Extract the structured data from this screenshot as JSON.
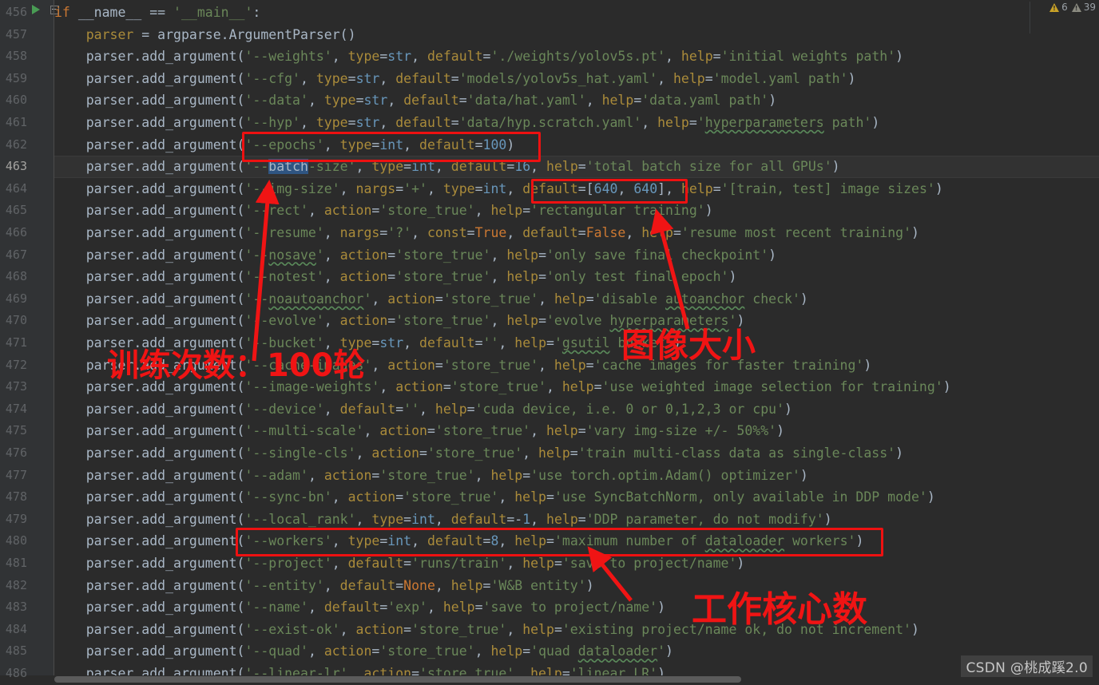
{
  "editor": {
    "first_line_number": 456,
    "current_line_number": 463,
    "selected_text": "batch",
    "lines": [
      {
        "n": 456,
        "text": "if __name__ == '__main__':"
      },
      {
        "n": 457,
        "text": "    parser = argparse.ArgumentParser()"
      },
      {
        "n": 458,
        "text": "    parser.add_argument('--weights', type=str, default='./weights/yolov5s.pt', help='initial weights path')"
      },
      {
        "n": 459,
        "text": "    parser.add_argument('--cfg', type=str, default='models/yolov5s_hat.yaml', help='model.yaml path')"
      },
      {
        "n": 460,
        "text": "    parser.add_argument('--data', type=str, default='data/hat.yaml', help='data.yaml path')"
      },
      {
        "n": 461,
        "text": "    parser.add_argument('--hyp', type=str, default='data/hyp.scratch.yaml', help='hyperparameters path')"
      },
      {
        "n": 462,
        "text": "    parser.add_argument('--epochs', type=int, default=100)"
      },
      {
        "n": 463,
        "text": "    parser.add_argument('--batch-size', type=int, default=16, help='total batch size for all GPUs')"
      },
      {
        "n": 464,
        "text": "    parser.add_argument('--img-size', nargs='+', type=int, default=[640, 640], help='[train, test] image sizes')"
      },
      {
        "n": 465,
        "text": "    parser.add_argument('--rect', action='store_true', help='rectangular training')"
      },
      {
        "n": 466,
        "text": "    parser.add_argument('--resume', nargs='?', const=True, default=False, help='resume most recent training')"
      },
      {
        "n": 467,
        "text": "    parser.add_argument('--nosave', action='store_true', help='only save final checkpoint')"
      },
      {
        "n": 468,
        "text": "    parser.add_argument('--notest', action='store_true', help='only test final epoch')"
      },
      {
        "n": 469,
        "text": "    parser.add_argument('--noautoanchor', action='store_true', help='disable autoanchor check')"
      },
      {
        "n": 470,
        "text": "    parser.add_argument('--evolve', action='store_true', help='evolve hyperparameters')"
      },
      {
        "n": 471,
        "text": "    parser.add_argument('--bucket', type=str, default='', help='gsutil bucket')"
      },
      {
        "n": 472,
        "text": "    parser.add_argument('--cache-images', action='store_true', help='cache images for faster training')"
      },
      {
        "n": 473,
        "text": "    parser.add_argument('--image-weights', action='store_true', help='use weighted image selection for training')"
      },
      {
        "n": 474,
        "text": "    parser.add_argument('--device', default='', help='cuda device, i.e. 0 or 0,1,2,3 or cpu')"
      },
      {
        "n": 475,
        "text": "    parser.add_argument('--multi-scale', action='store_true', help='vary img-size +/- 50%%')"
      },
      {
        "n": 476,
        "text": "    parser.add_argument('--single-cls', action='store_true', help='train multi-class data as single-class')"
      },
      {
        "n": 477,
        "text": "    parser.add_argument('--adam', action='store_true', help='use torch.optim.Adam() optimizer')"
      },
      {
        "n": 478,
        "text": "    parser.add_argument('--sync-bn', action='store_true', help='use SyncBatchNorm, only available in DDP mode')"
      },
      {
        "n": 479,
        "text": "    parser.add_argument('--local_rank', type=int, default=-1, help='DDP parameter, do not modify')"
      },
      {
        "n": 480,
        "text": "    parser.add_argument('--workers', type=int, default=8, help='maximum number of dataloader workers')"
      },
      {
        "n": 481,
        "text": "    parser.add_argument('--project', default='runs/train', help='save to project/name')"
      },
      {
        "n": 482,
        "text": "    parser.add_argument('--entity', default=None, help='W&B entity')"
      },
      {
        "n": 483,
        "text": "    parser.add_argument('--name', default='exp', help='save to project/name')"
      },
      {
        "n": 484,
        "text": "    parser.add_argument('--exist-ok', action='store_true', help='existing project/name ok, do not increment')"
      },
      {
        "n": 485,
        "text": "    parser.add_argument('--quad', action='store_true', help='quad dataloader')"
      },
      {
        "n": 486,
        "text": "    parser.add_argument('--linear-lr', action='store_true', help='linear LR')"
      }
    ]
  },
  "inspections": {
    "warning_count": "6",
    "weak_warning_count": "39"
  },
  "annotations": [
    {
      "id": "epochs-label",
      "text": "训练次数：100轮"
    },
    {
      "id": "imgsize-label",
      "text": "图像大小"
    },
    {
      "id": "workers-label",
      "text": "工作核心数"
    }
  ],
  "watermark": "CSDN @桃成蹊2.0",
  "colors": {
    "background": "#2b2b2b",
    "gutter": "#313335",
    "default_text": "#a9b7c6",
    "keyword": "#cc7832",
    "string": "#6a8759",
    "number": "#6897bb",
    "kwarg": "#aa8b3a",
    "constant": "#9876aa",
    "selection": "#2f5582",
    "annotation_red": "#ee1111",
    "current_line": "#323232"
  }
}
